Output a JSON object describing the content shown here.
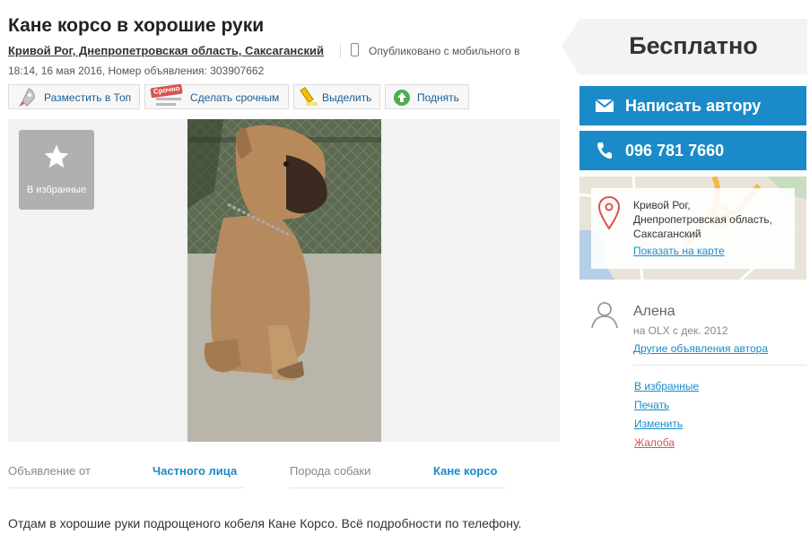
{
  "ad": {
    "title": "Кане корсо в хорошие руки",
    "location": "Кривой Рог, Днепропетровская область, Саксаганский",
    "published_mobile": "Опубликовано с мобильного в",
    "published_meta": "18:14, 16 мая 2016, Номер объявления: 303907662"
  },
  "actions": {
    "top": "Разместить в Топ",
    "urgent": "Сделать срочным",
    "urgent_badge": "Срочно",
    "highlight": "Выделить",
    "raise": "Поднять"
  },
  "gallery": {
    "favorite_label": "В избранные"
  },
  "attributes": [
    {
      "label": "Объявление от",
      "value": "Частного лица"
    },
    {
      "label": "Порода собаки",
      "value": "Кане корсо"
    }
  ],
  "description": "Отдам в хорошие руки подрощеного кобеля Кане Корсо. Всё подробности по телефону.",
  "sidebar": {
    "price": "Бесплатно",
    "message_button": "Написать автору",
    "phone_button": "096 781 7660",
    "map": {
      "line1": "Кривой Рог,",
      "line2": "Днепропетровская область,",
      "line3": "Саксаганский",
      "link": "Показать на карте"
    },
    "seller": {
      "name": "Алена",
      "since": "на OLX с дек. 2012",
      "other_ads": "Другие объявления автора"
    },
    "links": {
      "favorites": "В избранные",
      "print": "Печать",
      "edit": "Изменить",
      "complaint": "Жалоба"
    }
  },
  "colors": {
    "accent": "#1a8bc8",
    "complaint": "#d9534f"
  }
}
